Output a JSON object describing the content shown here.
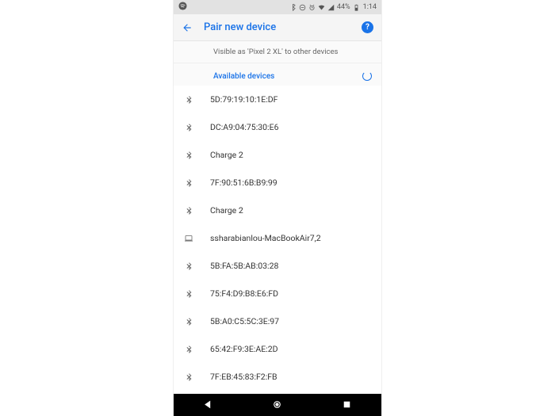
{
  "status": {
    "battery": "44%",
    "time": "1:14"
  },
  "header": {
    "title": "Pair new device"
  },
  "visibility": "Visible as 'Pixel 2 XL' to other devices",
  "section_label": "Available devices",
  "devices": [
    {
      "name": "5D:79:19:10:1E:DF",
      "type": "bt"
    },
    {
      "name": "DC:A9:04:75:30:E6",
      "type": "bt"
    },
    {
      "name": "Charge 2",
      "type": "bt"
    },
    {
      "name": "7F:90:51:6B:B9:99",
      "type": "bt"
    },
    {
      "name": "Charge 2",
      "type": "bt"
    },
    {
      "name": "ssharabianlou-MacBookAir7,2",
      "type": "laptop"
    },
    {
      "name": "5B:FA:5B:AB:03:28",
      "type": "bt"
    },
    {
      "name": "75:F4:D9:B8:E6:FD",
      "type": "bt"
    },
    {
      "name": "5B:A0:C5:5C:3E:97",
      "type": "bt"
    },
    {
      "name": "65:42:F9:3E:AE:2D",
      "type": "bt"
    },
    {
      "name": "7F:EB:45:83:F2:FB",
      "type": "bt"
    }
  ]
}
